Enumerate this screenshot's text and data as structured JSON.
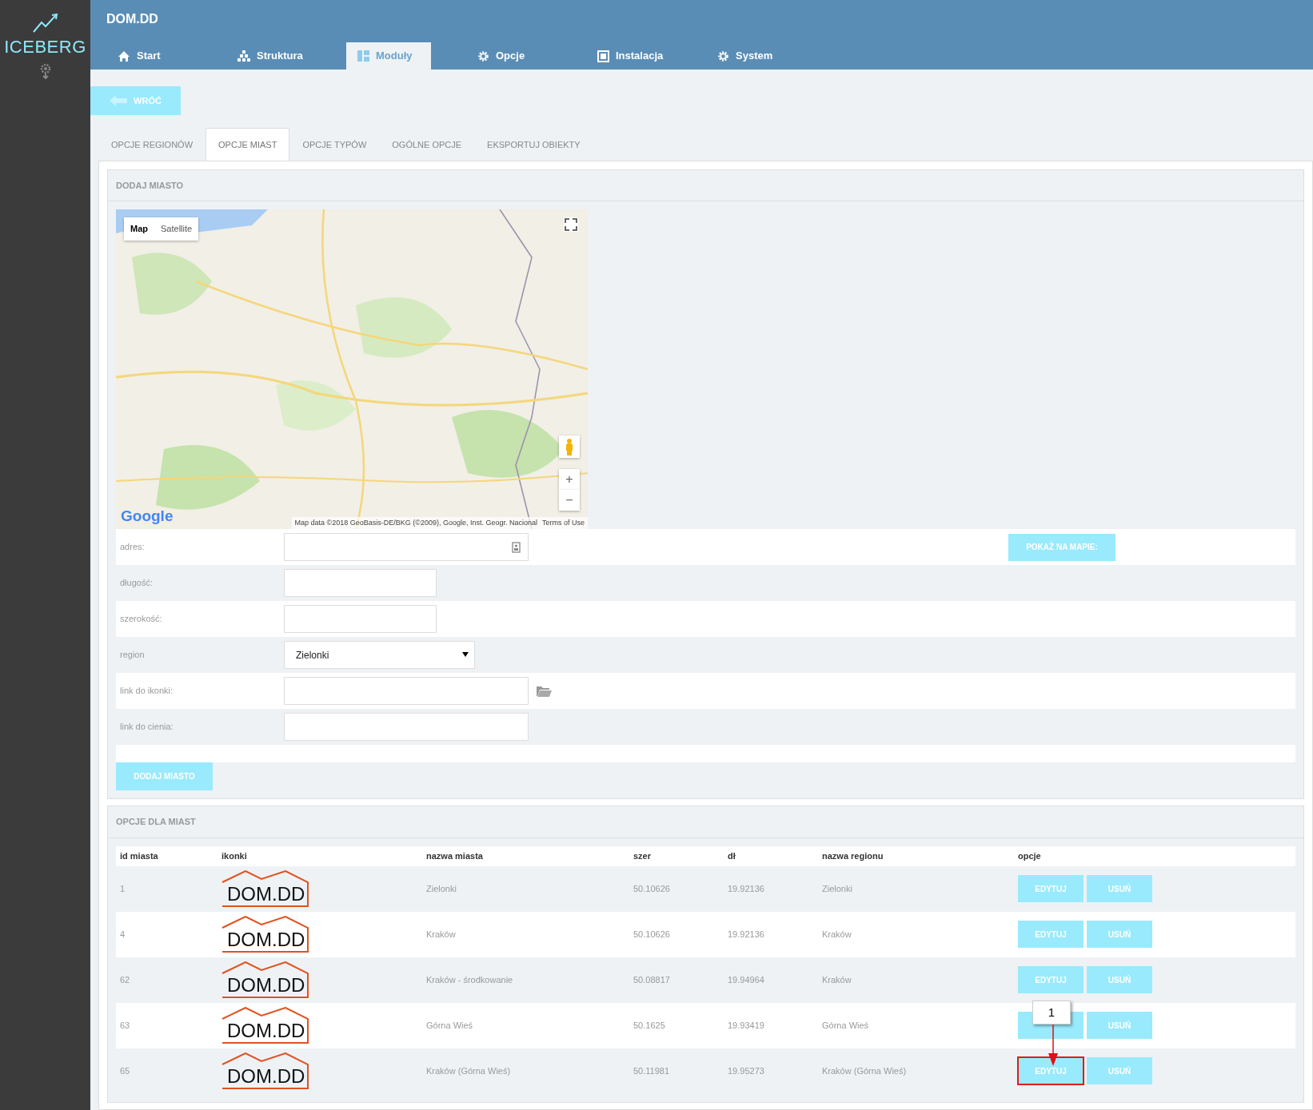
{
  "sidebar": {
    "brand": "ICEBERG"
  },
  "header": {
    "title": "DOM.DD"
  },
  "nav": [
    {
      "label": "Start",
      "selected": false
    },
    {
      "label": "Struktura",
      "selected": false
    },
    {
      "label": "Moduły",
      "selected": true
    },
    {
      "label": "Opcje",
      "selected": false
    },
    {
      "label": "Instalacja",
      "selected": false
    },
    {
      "label": "System",
      "selected": false
    }
  ],
  "back_button": "WRÓĆ",
  "tabs": [
    {
      "label": "OPCJE REGIONÓW",
      "selected": false
    },
    {
      "label": "OPCJE MIAST",
      "selected": true
    },
    {
      "label": "OPCJE TYPÓW",
      "selected": false
    },
    {
      "label": "OGÓLNE OPCJE",
      "selected": false
    },
    {
      "label": "EKSPORTUJ OBIEKTY",
      "selected": false
    }
  ],
  "add_city": {
    "title": "DODAJ MIASTO",
    "map": {
      "type_buttons": [
        {
          "label": "Map",
          "selected": true
        },
        {
          "label": "Satellite",
          "selected": false
        }
      ],
      "logo": "Google",
      "attribution": "Map data ©2018 GeoBasis-DE/BKG (©2009), Google, Inst. Geogr. Nacional",
      "terms": "Terms of Use",
      "zoom_in": "+",
      "zoom_out": "−"
    },
    "fields": [
      {
        "label": "adres:",
        "kind": "address",
        "button": "POKAŻ NA MAPIE:"
      },
      {
        "label": "długość:",
        "kind": "short"
      },
      {
        "label": "szerokość:",
        "kind": "short"
      },
      {
        "label": "region",
        "kind": "select",
        "value": "Zielonki"
      },
      {
        "label": "link do ikonki:",
        "kind": "file"
      },
      {
        "label": "link do cienia:",
        "kind": "wide"
      }
    ],
    "submit": "DODAJ MIASTO"
  },
  "cities": {
    "title": "OPCJE DLA MIAST",
    "columns": [
      "id miasta",
      "ikonki",
      "nazwa miasta",
      "szer",
      "dł",
      "nazwa regionu",
      "opcje"
    ],
    "rows": [
      {
        "id": "1",
        "icon": "DOM.DD",
        "name": "Zielonki",
        "lat": "50.10626",
        "lng": "19.92136",
        "region": "Zielonki",
        "edit": "EDYTUJ",
        "delete": "USUŃ",
        "highlighted": false
      },
      {
        "id": "4",
        "icon": "DOM.DD",
        "name": "Kraków",
        "lat": "50.10626",
        "lng": "19.92136",
        "region": "Kraków",
        "edit": "EDYTUJ",
        "delete": "USUŃ",
        "highlighted": false
      },
      {
        "id": "62",
        "icon": "DOM.DD",
        "name": "Kraków - środkowanie",
        "lat": "50.08817",
        "lng": "19.94964",
        "region": "Kraków",
        "edit": "EDYTUJ",
        "delete": "USUŃ",
        "highlighted": false
      },
      {
        "id": "63",
        "icon": "DOM.DD",
        "name": "Górna Wieś",
        "lat": "50.1625",
        "lng": "19.93419",
        "region": "Górna Wieś",
        "delete": "USUŃ",
        "highlighted": false,
        "callout": "1"
      },
      {
        "id": "65",
        "icon": "DOM.DD",
        "name": "Kraków (Górna Wieś)",
        "lat": "50.11981",
        "lng": "19.95273",
        "region": "Kraków (Górna Wieś)",
        "edit": "EDYTUJ",
        "delete": "USUŃ",
        "highlighted": true
      }
    ]
  }
}
